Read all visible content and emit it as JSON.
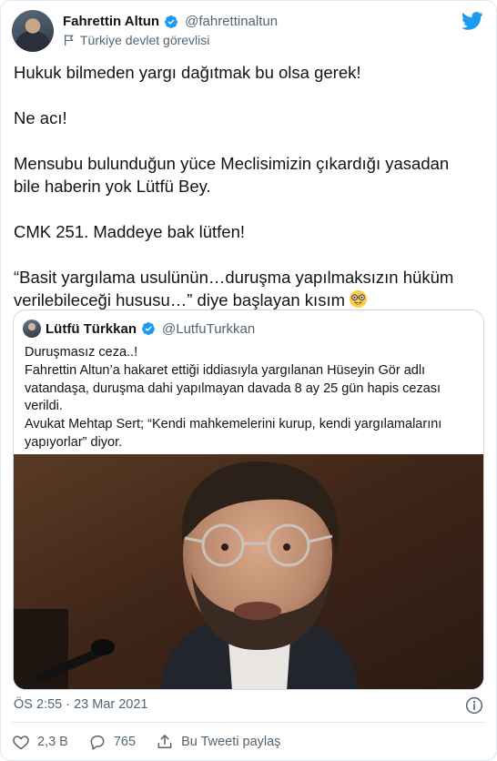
{
  "author": {
    "name": "Fahrettin Altun",
    "handle": "@fahrettinaltun",
    "label": "Türkiye devlet görevlisi"
  },
  "tweet": {
    "paragraphs": [
      "Hukuk bilmeden yargı dağıtmak bu olsa gerek!",
      "Ne acı!",
      "Mensubu bulunduğun yüce Meclisimizin çıkardığı yasadan",
      "bile haberin yok Lütfü Bey.",
      "CMK 251. Maddeye bak lütfen!",
      "“Basit yargılama usulünün…duruşma yapılmaksızın hüküm",
      "verilebileceği hususu…” diye başlayan kısım"
    ],
    "emoji": "nerd-face-emoji"
  },
  "quote": {
    "name": "Lütfü Türkkan",
    "handle": "@LutfuTurkkan",
    "lines": [
      "Duruşmasız ceza..!",
      "Fahrettin Altun’a hakaret ettiği iddiasıyla yargılanan Hüseyin Gör adlı",
      "vatandaşa, duruşma dahi yapılmayan davada 8 ay 25 gün hapis cezası",
      "verildi.",
      "Avukat Mehtap Sert; “Kendi mahkemelerini kurup, kendi yargılamalarını",
      "yapıyorlar” diyor."
    ],
    "image": "photo-of-man-with-glasses-speaking-into-microphone"
  },
  "timestamp": "ÖS 2:55 · 23 Mar 2021",
  "actions": {
    "likes": "2,3 B",
    "replies": "765",
    "share_label": "Bu Tweeti paylaş"
  },
  "colors": {
    "brand": "#1d9bf0",
    "text": "#0f1419",
    "secondary": "#536471",
    "border": "#cfd9de"
  }
}
